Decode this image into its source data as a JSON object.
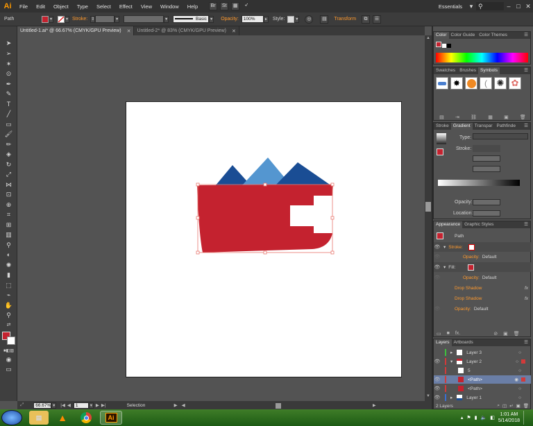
{
  "app": {
    "logo": "Ai",
    "menus": [
      "File",
      "Edit",
      "Object",
      "Type",
      "Select",
      "Effect",
      "View",
      "Window",
      "Help"
    ],
    "workspace": "Essentials",
    "window_controls": [
      "–",
      "□",
      "✕"
    ]
  },
  "control_bar": {
    "selection_label": "Path",
    "stroke_label": "Stroke:",
    "brush_label": "Basic",
    "opacity_label": "Opacity:",
    "opacity_value": "100%",
    "style_label": "Style:",
    "transform_label": "Transform",
    "fill_color": "#c4222f",
    "accent_color": "#ff9a2e"
  },
  "document_tabs": [
    {
      "label": "Untitled-1.ai* @ 66.67% (CMYK/GPU Preview)",
      "active": true,
      "close": "✕"
    },
    {
      "label": "Untitled-2* @ 83% (CMYK/GPU Preview)",
      "active": false,
      "close": "✕"
    }
  ],
  "status_bar": {
    "zoom": "66.67%",
    "artboard_number": "1",
    "tool_name": "Selection"
  },
  "color_panel": {
    "tabs": [
      "Color",
      "Color Guide",
      "Color Themes"
    ]
  },
  "symbols_panel": {
    "tabs": [
      "Swatches",
      "Brushes",
      "Symbols"
    ]
  },
  "gradient_panel": {
    "tabs": [
      "Stroke",
      "Gradient",
      "Transpar",
      "Pathfinde"
    ],
    "type_label": "Type:",
    "stroke_label": "Stroke:",
    "opacity_label": "Opacity:",
    "location_label": "Location:"
  },
  "appearance_panel": {
    "tabs": [
      "Appearance",
      "Graphic Styles"
    ],
    "title": "Path",
    "rows": [
      {
        "label": "Stroke:",
        "orange": true,
        "value": ""
      },
      {
        "label": "Opacity:",
        "orange": true,
        "value": "Default"
      },
      {
        "label": "Fill:",
        "orange": false,
        "value": ""
      },
      {
        "label": "Opacity:",
        "orange": true,
        "value": "Default"
      },
      {
        "label": "Drop Shadow",
        "orange": true,
        "value": ""
      },
      {
        "label": "Drop Shadow",
        "orange": true,
        "value": ""
      },
      {
        "label": "Opacity:",
        "orange": true,
        "value": "Default"
      }
    ],
    "fx": "fx"
  },
  "layers_panel": {
    "tabs": [
      "Layers",
      "Artboards"
    ],
    "rows": [
      {
        "name": "Layer 3",
        "color": "#3fbf3f"
      },
      {
        "name": "Layer 2",
        "color": "#d23a3a"
      },
      {
        "name": "5",
        "color": "#d23a3a"
      },
      {
        "name": "<Path>",
        "color": "#d23a3a"
      },
      {
        "name": "<Path>",
        "color": "#d23a3a"
      },
      {
        "name": "Layer 1",
        "color": "#3a6fd2"
      }
    ],
    "count": "2 Layers"
  },
  "taskbar": {
    "ai_label": "Ai",
    "time": "1:01 AM",
    "date": "5/14/2018"
  }
}
